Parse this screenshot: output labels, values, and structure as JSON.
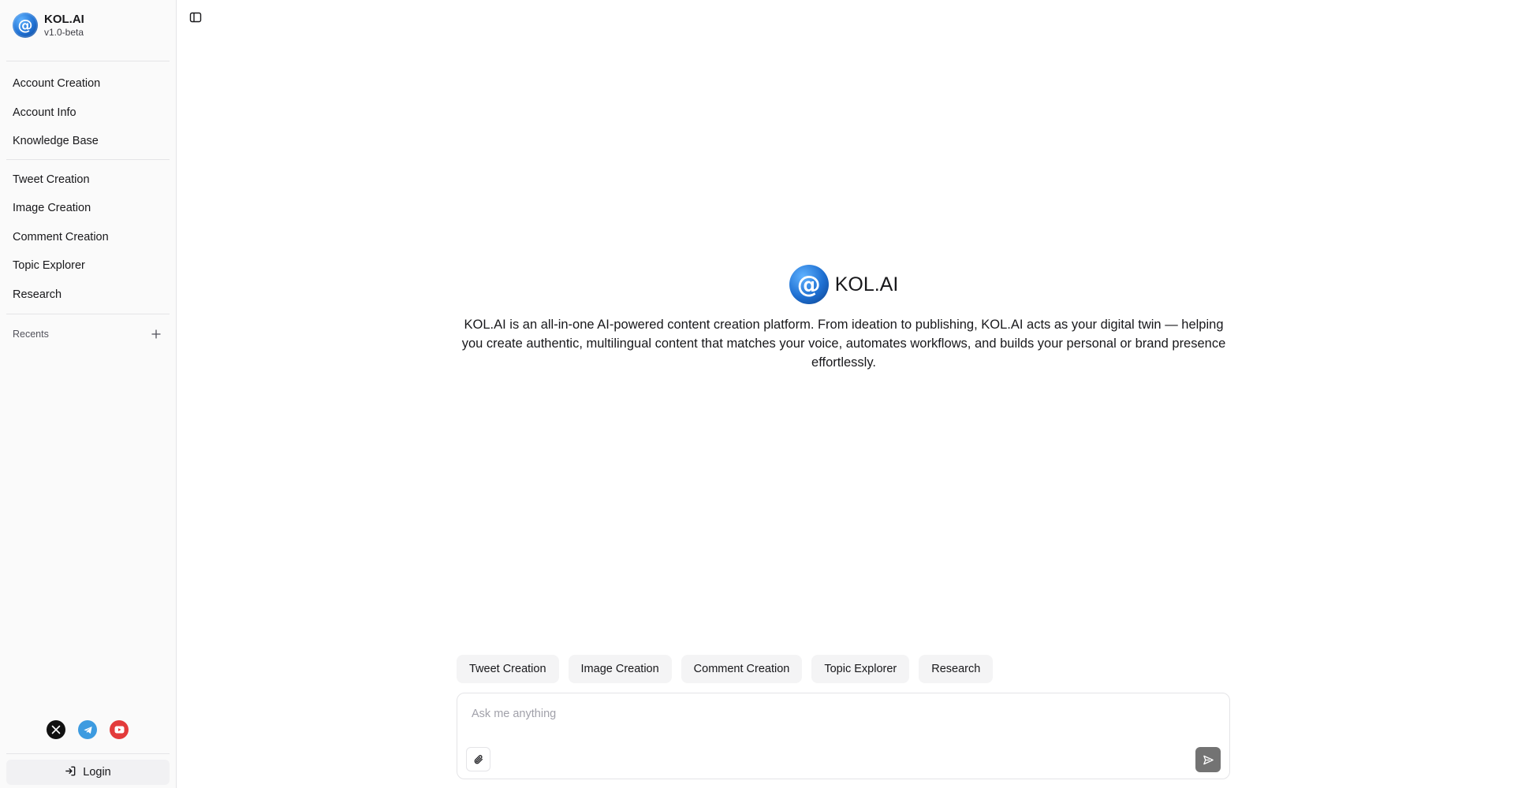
{
  "brand": {
    "logo_glyph": "@",
    "name": "KOL.AI",
    "version": "v1.0-beta"
  },
  "sidebar": {
    "group1": [
      {
        "label": "Account Creation"
      },
      {
        "label": "Account Info"
      },
      {
        "label": "Knowledge Base"
      }
    ],
    "group2": [
      {
        "label": "Tweet Creation"
      },
      {
        "label": "Image Creation"
      },
      {
        "label": "Comment Creation"
      },
      {
        "label": "Topic Explorer"
      },
      {
        "label": "Research"
      }
    ],
    "recents_label": "Recents",
    "recents_add_icon": "plus-icon",
    "socials": [
      {
        "icon": "x-icon",
        "color": "#111111"
      },
      {
        "icon": "telegram-icon",
        "color": "#3d9be0"
      },
      {
        "icon": "youtube-icon",
        "color": "#e33b3b"
      }
    ],
    "login_label": "Login",
    "login_icon": "login-icon"
  },
  "main": {
    "toggle_icon": "sidebar-toggle-icon",
    "hero": {
      "title": "KOL.AI",
      "description": "KOL.AI is an all-in-one AI-powered content creation platform. From ideation to publishing, KOL.AI acts as your digital twin — helping you create authentic, multilingual content that matches your voice, automates workflows, and builds your personal or brand presence effortlessly."
    },
    "chips": [
      {
        "label": "Tweet Creation"
      },
      {
        "label": "Image Creation"
      },
      {
        "label": "Comment Creation"
      },
      {
        "label": "Topic Explorer"
      },
      {
        "label": "Research"
      }
    ],
    "composer": {
      "placeholder": "Ask me anything",
      "value": "",
      "attach_icon": "paperclip-icon",
      "send_icon": "send-icon"
    }
  },
  "colors": {
    "accent_logo": "#1e6fd1",
    "sidebar_bg": "#fafafa",
    "chip_bg": "#f4f4f5",
    "send_bg": "#737373"
  }
}
